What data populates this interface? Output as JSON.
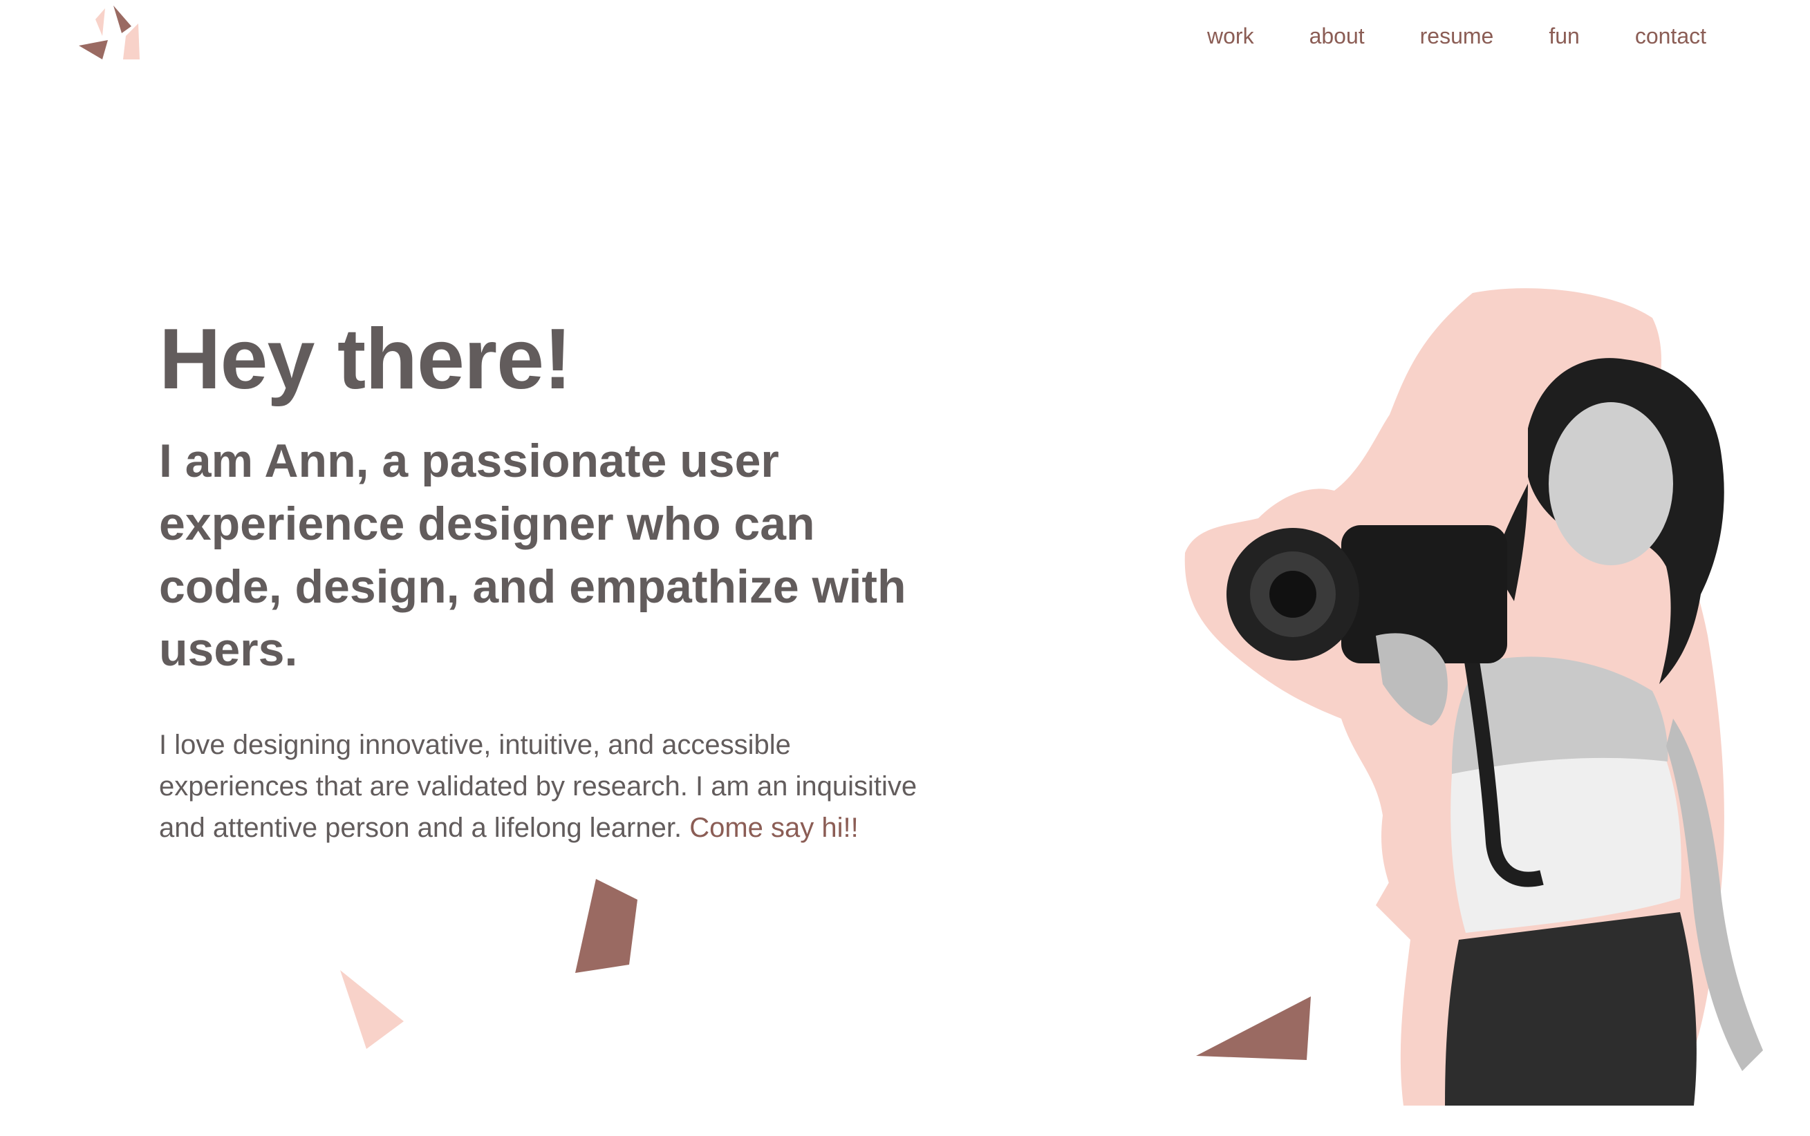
{
  "header": {
    "logo_icon": "initials-logo-icon",
    "nav": [
      {
        "label": "work"
      },
      {
        "label": "about"
      },
      {
        "label": "resume"
      },
      {
        "label": "fun"
      },
      {
        "label": "contact"
      }
    ]
  },
  "hero": {
    "greeting": "Hey there!",
    "headline": "I am Ann, a passionate user experience designer who can code, design, and empathize with users.",
    "body": "I love designing innovative, intuitive, and accessible experiences that are validated by research. I am an inquisitive and attentive person and a lifelong learner. ",
    "cta": "Come say hi!!"
  },
  "colors": {
    "accent": "#8b5d55",
    "text": "#625c5c",
    "blush": "#f8d2c9",
    "shape_dark": "#9a6a62"
  },
  "photo": {
    "subject": "woman-holding-camera-photo"
  }
}
